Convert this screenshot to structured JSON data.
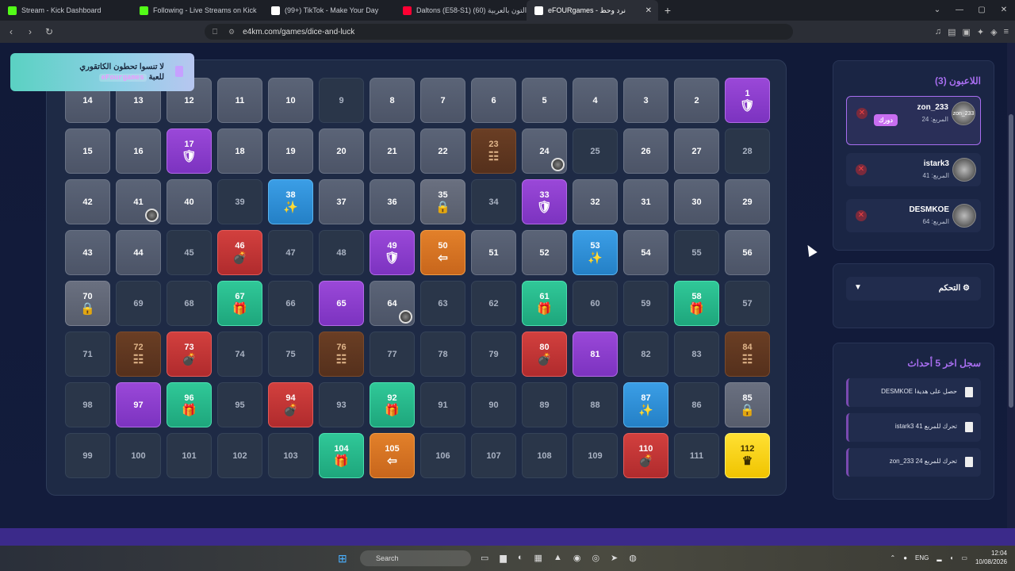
{
  "browser": {
    "tabs": [
      {
        "title": "Stream - Kick Dashboard",
        "favicon_color": "#53fc18",
        "active": false
      },
      {
        "title": "Following - Live Streams on Kick",
        "favicon_color": "#53fc18",
        "active": false
      },
      {
        "title": "(99+) TikTok - Make Your Day",
        "favicon_color": "#ffffff",
        "active": false
      },
      {
        "title": "Daltons (E58-S1) الدالتون بالعربية (60)",
        "favicon_color": "#ff0033",
        "active": false
      },
      {
        "title": "eFOURgames - نرد وحظ",
        "favicon_color": "#ffffff",
        "active": true
      }
    ],
    "url": "e4km.com/games/dice-and-luck"
  },
  "toast": {
    "line1": "لا تنسوا تحطون الكاتقوري",
    "line2_prefix": "للعبة",
    "line2_code": "eFourgames"
  },
  "board": {
    "cells": [
      [
        {
          "n": "14",
          "t": "gray"
        },
        {
          "n": "13",
          "t": "gray"
        },
        {
          "n": "12",
          "t": "gray"
        },
        {
          "n": "11",
          "t": "gray"
        },
        {
          "n": "10",
          "t": "gray"
        },
        {
          "n": "9",
          "t": "dark"
        },
        {
          "n": "8",
          "t": "gray"
        },
        {
          "n": "7",
          "t": "gray"
        },
        {
          "n": "6",
          "t": "gray"
        },
        {
          "n": "5",
          "t": "gray"
        },
        {
          "n": "4",
          "t": "gray"
        },
        {
          "n": "3",
          "t": "gray"
        },
        {
          "n": "2",
          "t": "gray"
        },
        {
          "n": "1",
          "t": "purple",
          "icon": "shield"
        }
      ],
      [
        {
          "n": "15",
          "t": "gray"
        },
        {
          "n": "16",
          "t": "gray"
        },
        {
          "n": "17",
          "t": "purple",
          "icon": "shield"
        },
        {
          "n": "18",
          "t": "gray"
        },
        {
          "n": "19",
          "t": "gray"
        },
        {
          "n": "20",
          "t": "gray"
        },
        {
          "n": "21",
          "t": "gray"
        },
        {
          "n": "22",
          "t": "gray"
        },
        {
          "n": "23",
          "t": "brown",
          "icon": "ladder"
        },
        {
          "n": "24",
          "t": "gray",
          "token": true
        },
        {
          "n": "25",
          "t": "dark"
        },
        {
          "n": "26",
          "t": "gray"
        },
        {
          "n": "27",
          "t": "gray"
        },
        {
          "n": "28",
          "t": "dark"
        }
      ],
      [
        {
          "n": "42",
          "t": "gray"
        },
        {
          "n": "41",
          "t": "gray",
          "token": true
        },
        {
          "n": "40",
          "t": "gray"
        },
        {
          "n": "39",
          "t": "dark"
        },
        {
          "n": "38",
          "t": "blue",
          "icon": "star"
        },
        {
          "n": "37",
          "t": "gray"
        },
        {
          "n": "36",
          "t": "gray"
        },
        {
          "n": "35",
          "t": "lock",
          "icon": "lock"
        },
        {
          "n": "34",
          "t": "dark"
        },
        {
          "n": "33",
          "t": "purple",
          "icon": "shield"
        },
        {
          "n": "32",
          "t": "gray"
        },
        {
          "n": "31",
          "t": "gray"
        },
        {
          "n": "30",
          "t": "gray"
        },
        {
          "n": "29",
          "t": "gray"
        }
      ],
      [
        {
          "n": "43",
          "t": "gray"
        },
        {
          "n": "44",
          "t": "gray"
        },
        {
          "n": "45",
          "t": "dark"
        },
        {
          "n": "46",
          "t": "red",
          "icon": "bomb"
        },
        {
          "n": "47",
          "t": "dark"
        },
        {
          "n": "48",
          "t": "dark"
        },
        {
          "n": "49",
          "t": "purple",
          "icon": "shield"
        },
        {
          "n": "50",
          "t": "orange",
          "icon": "back"
        },
        {
          "n": "51",
          "t": "gray"
        },
        {
          "n": "52",
          "t": "gray"
        },
        {
          "n": "53",
          "t": "blue",
          "icon": "star"
        },
        {
          "n": "54",
          "t": "gray"
        },
        {
          "n": "55",
          "t": "dark"
        },
        {
          "n": "56",
          "t": "gray"
        }
      ],
      [
        {
          "n": "70",
          "t": "lock",
          "icon": "lock"
        },
        {
          "n": "69",
          "t": "dark"
        },
        {
          "n": "68",
          "t": "dark"
        },
        {
          "n": "67",
          "t": "green",
          "icon": "gift"
        },
        {
          "n": "66",
          "t": "dark"
        },
        {
          "n": "65",
          "t": "purple"
        },
        {
          "n": "64",
          "t": "gray",
          "token": true
        },
        {
          "n": "63",
          "t": "dark"
        },
        {
          "n": "62",
          "t": "dark"
        },
        {
          "n": "61",
          "t": "green",
          "icon": "gift"
        },
        {
          "n": "60",
          "t": "dark"
        },
        {
          "n": "59",
          "t": "dark"
        },
        {
          "n": "58",
          "t": "green",
          "icon": "gift"
        },
        {
          "n": "57",
          "t": "dark"
        }
      ],
      [
        {
          "n": "71",
          "t": "dark"
        },
        {
          "n": "72",
          "t": "brown",
          "icon": "ladder"
        },
        {
          "n": "73",
          "t": "red",
          "icon": "bomb"
        },
        {
          "n": "74",
          "t": "dark"
        },
        {
          "n": "75",
          "t": "dark"
        },
        {
          "n": "76",
          "t": "brown",
          "icon": "ladder"
        },
        {
          "n": "77",
          "t": "dark"
        },
        {
          "n": "78",
          "t": "dark"
        },
        {
          "n": "79",
          "t": "dark"
        },
        {
          "n": "80",
          "t": "red",
          "icon": "bomb"
        },
        {
          "n": "81",
          "t": "purple"
        },
        {
          "n": "82",
          "t": "dark"
        },
        {
          "n": "83",
          "t": "dark"
        },
        {
          "n": "84",
          "t": "brown",
          "icon": "ladder"
        }
      ],
      [
        {
          "n": "98",
          "t": "dark"
        },
        {
          "n": "97",
          "t": "purple"
        },
        {
          "n": "96",
          "t": "green",
          "icon": "gift"
        },
        {
          "n": "95",
          "t": "dark"
        },
        {
          "n": "94",
          "t": "red",
          "icon": "bomb"
        },
        {
          "n": "93",
          "t": "dark"
        },
        {
          "n": "92",
          "t": "green",
          "icon": "gift"
        },
        {
          "n": "91",
          "t": "dark"
        },
        {
          "n": "90",
          "t": "dark"
        },
        {
          "n": "89",
          "t": "dark"
        },
        {
          "n": "88",
          "t": "dark"
        },
        {
          "n": "87",
          "t": "blue",
          "icon": "star"
        },
        {
          "n": "86",
          "t": "dark"
        },
        {
          "n": "85",
          "t": "lock",
          "icon": "lock"
        }
      ],
      [
        {
          "n": "99",
          "t": "dark"
        },
        {
          "n": "100",
          "t": "dark"
        },
        {
          "n": "101",
          "t": "dark"
        },
        {
          "n": "102",
          "t": "dark"
        },
        {
          "n": "103",
          "t": "dark"
        },
        {
          "n": "104",
          "t": "green",
          "icon": "gift"
        },
        {
          "n": "105",
          "t": "orange",
          "icon": "back"
        },
        {
          "n": "106",
          "t": "dark"
        },
        {
          "n": "107",
          "t": "dark"
        },
        {
          "n": "108",
          "t": "dark"
        },
        {
          "n": "109",
          "t": "dark"
        },
        {
          "n": "110",
          "t": "red",
          "icon": "bomb"
        },
        {
          "n": "111",
          "t": "dark"
        },
        {
          "n": "112",
          "t": "yellow",
          "icon": "crown"
        }
      ]
    ]
  },
  "players_panel": {
    "title": "اللاعبون (3)",
    "players": [
      {
        "name": "zon_233",
        "square_label": "المربع:",
        "square": "24",
        "avatar": "zon_233",
        "badge": "دورك",
        "current": true
      },
      {
        "name": "istark3",
        "square_label": "المربع:",
        "square": "41",
        "avatar": "",
        "current": false
      },
      {
        "name": "DESMKOE",
        "square_label": "المربع:",
        "square": "64",
        "avatar": "",
        "current": false
      }
    ]
  },
  "control_panel": {
    "label": "التحكم"
  },
  "log_panel": {
    "title": "سجل اخر 5 أحداث",
    "entries": [
      "DESMKOE حصل على هديةا",
      "istark3 تحرك للمربع 41",
      "zon_233 تحرك للمربع 24"
    ]
  },
  "taskbar": {
    "search": "Search",
    "lang": "ENG",
    "time": "12:04",
    "date": "10/08/2026"
  }
}
